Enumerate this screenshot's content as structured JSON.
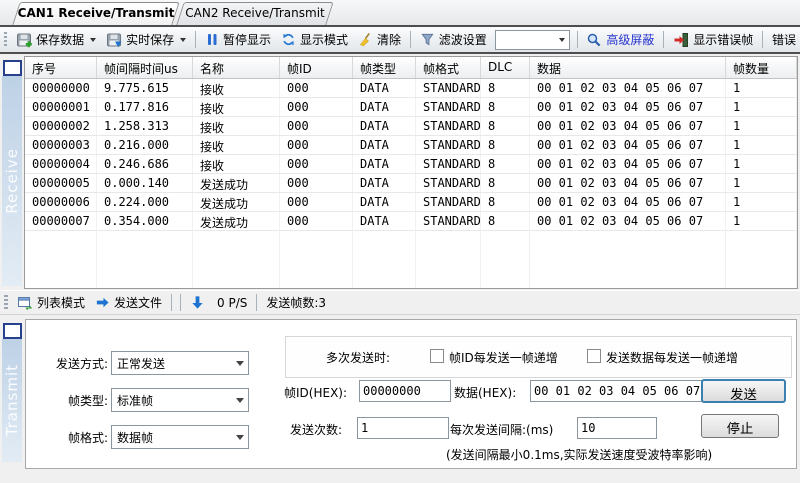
{
  "tabs": [
    {
      "label": "CAN1 Receive/Transmit"
    },
    {
      "label": "CAN2 Receive/Transmit"
    }
  ],
  "toolbar": {
    "save_data": "保存数据",
    "realtime_save": "实时保存",
    "pause_display": "暂停显示",
    "display_mode": "显示模式",
    "clear": "清除",
    "filter_settings": "滤波设置",
    "filter_combo_value": "",
    "advanced_mask": "高级屏蔽",
    "show_error_frames": "显示错误帧",
    "clipped_item": "错误"
  },
  "receive": {
    "sidebar_label": "Receive",
    "table": {
      "headers": [
        "序号",
        "帧间隔时间us",
        "名称",
        "帧ID",
        "帧类型",
        "帧格式",
        "DLC",
        "数据",
        "帧数量"
      ],
      "rows": [
        [
          "00000000",
          "9.775.615",
          "接收",
          "000",
          "DATA",
          "STANDARD",
          "8",
          "00 01 02 03 04 05 06 07",
          "1"
        ],
        [
          "00000001",
          "0.177.816",
          "接收",
          "000",
          "DATA",
          "STANDARD",
          "8",
          "00 01 02 03 04 05 06 07",
          "1"
        ],
        [
          "00000002",
          "1.258.313",
          "接收",
          "000",
          "DATA",
          "STANDARD",
          "8",
          "00 01 02 03 04 05 06 07",
          "1"
        ],
        [
          "00000003",
          "0.216.000",
          "接收",
          "000",
          "DATA",
          "STANDARD",
          "8",
          "00 01 02 03 04 05 06 07",
          "1"
        ],
        [
          "00000004",
          "0.246.686",
          "接收",
          "000",
          "DATA",
          "STANDARD",
          "8",
          "00 01 02 03 04 05 06 07",
          "1"
        ],
        [
          "00000005",
          "0.000.140",
          "发送成功",
          "000",
          "DATA",
          "STANDARD",
          "8",
          "00 01 02 03 04 05 06 07",
          "1"
        ],
        [
          "00000006",
          "0.224.000",
          "发送成功",
          "000",
          "DATA",
          "STANDARD",
          "8",
          "00 01 02 03 04 05 06 07",
          "1"
        ],
        [
          "00000007",
          "0.354.000",
          "发送成功",
          "000",
          "DATA",
          "STANDARD",
          "8",
          "00 01 02 03 04 05 06 07",
          "1"
        ]
      ]
    }
  },
  "tx_toolbar": {
    "list_mode": "列表模式",
    "send_file": "发送文件",
    "pps": "0 P/S",
    "frames_sent": "发送帧数:3"
  },
  "transmit": {
    "sidebar_label": "Transmit",
    "send_mode_label": "发送方式:",
    "send_mode_value": "正常发送",
    "frame_type_label": "帧类型:",
    "frame_type_value": "标准帧",
    "frame_format_label": "帧格式:",
    "frame_format_value": "数据帧",
    "multi_send_label": "多次发送时:",
    "inc_id_label": "帧ID每发送一帧递增",
    "inc_data_label": "发送数据每发送一帧递增",
    "frame_id_label": "帧ID(HEX):",
    "frame_id_value": "00000000",
    "data_label": "数据(HEX):",
    "data_value": "00 01 02 03 04 05 06 07",
    "send_button": "发送",
    "send_count_label": "发送次数:",
    "send_count_value": "1",
    "interval_label": "每次发送间隔:(ms)",
    "interval_value": "10",
    "stop_button": "停止",
    "note": "(发送间隔最小0.1ms,实际发送速度受波特率影响)"
  },
  "colors": {
    "advanced_mask_text": "#2633cc",
    "accent_blue": "#1e74d0",
    "sidebar_gradient_top": "#bdd1e6"
  }
}
